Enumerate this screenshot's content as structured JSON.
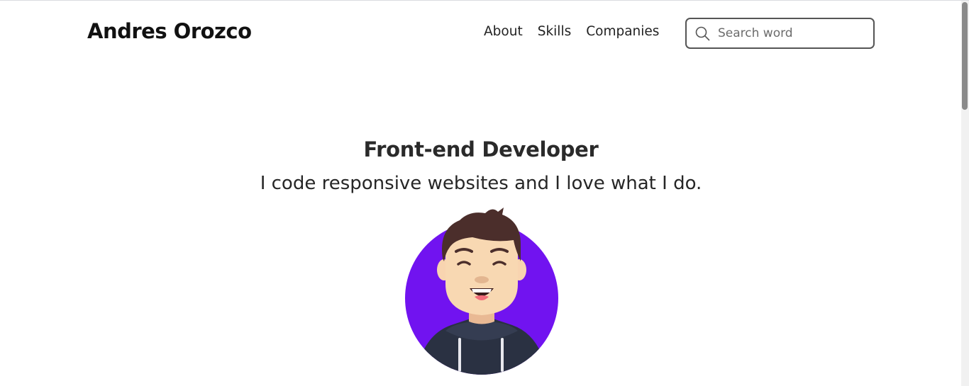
{
  "header": {
    "logo": "Andres Orozco",
    "nav": [
      {
        "label": "About"
      },
      {
        "label": "Skills"
      },
      {
        "label": "Companies"
      }
    ],
    "search": {
      "placeholder": "Search word",
      "value": "",
      "icon": "search-icon"
    }
  },
  "hero": {
    "title": "Front-end Developer",
    "subtitle": "I code responsive websites and I love what I do.",
    "avatar": {
      "icon": "developer-avatar",
      "background_color": "#7113f0"
    }
  }
}
